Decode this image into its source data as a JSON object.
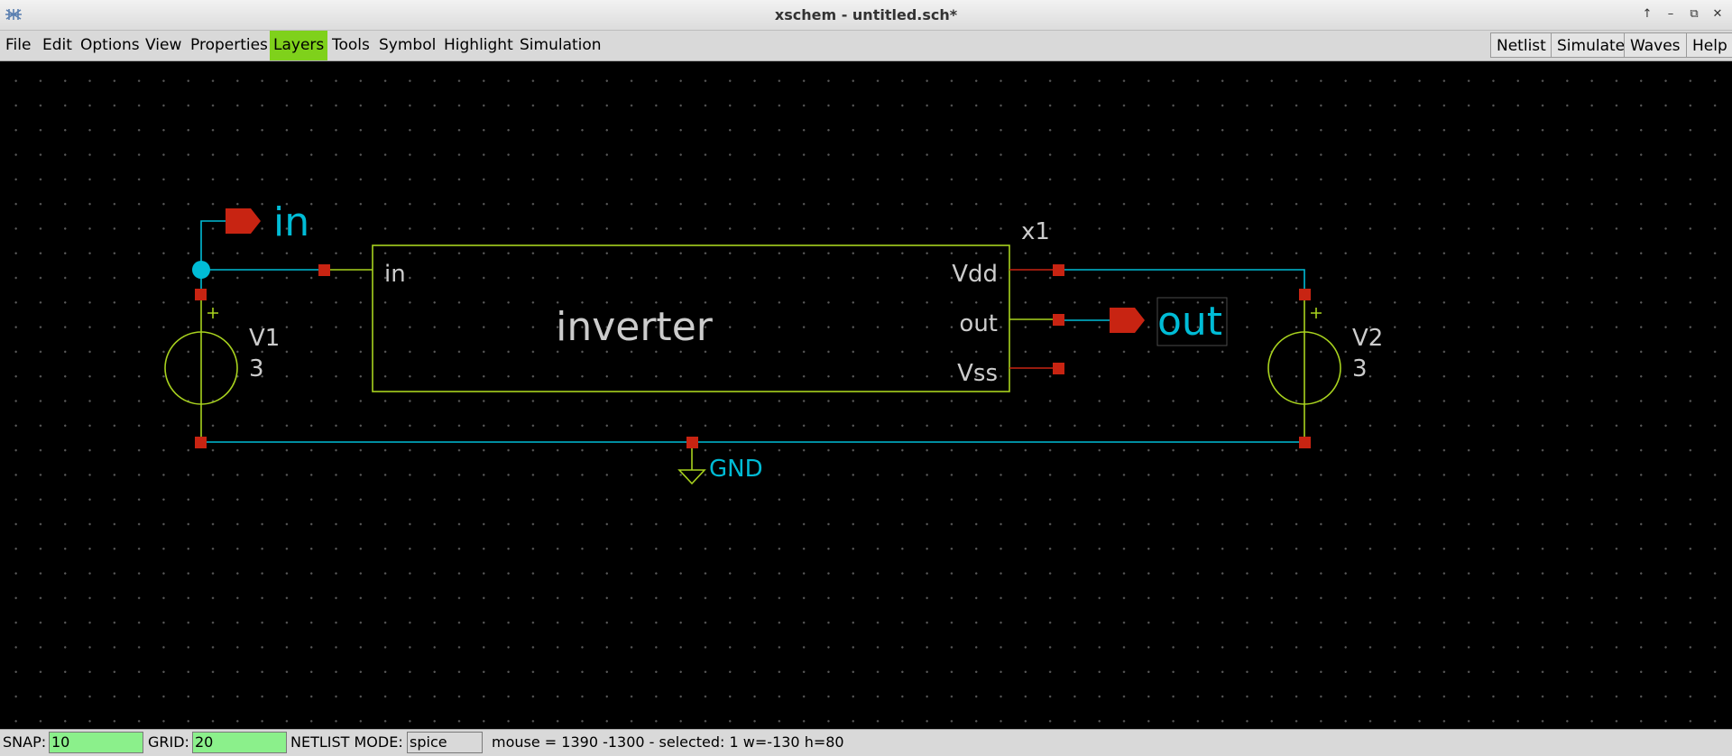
{
  "window": {
    "title": "xschem - untitled.sch*",
    "controls": [
      "up-arrow-icon",
      "minimize-icon",
      "restore-icon",
      "close-icon"
    ]
  },
  "menubar": {
    "items": [
      {
        "label": "File"
      },
      {
        "label": "Edit"
      },
      {
        "label": "Options"
      },
      {
        "label": "View"
      },
      {
        "label": "Properties"
      },
      {
        "label": "Layers",
        "active": true
      },
      {
        "label": "Tools"
      },
      {
        "label": "Symbol"
      },
      {
        "label": "Highlight"
      },
      {
        "label": "Simulation"
      }
    ],
    "right_buttons": [
      {
        "label": "Netlist"
      },
      {
        "label": "Simulate"
      },
      {
        "label": "Waves"
      },
      {
        "label": "Help"
      }
    ]
  },
  "schematic": {
    "instance_name": "x1",
    "symbol_name": "inverter",
    "pins": {
      "in": "in",
      "vdd": "Vdd",
      "out": "out",
      "vss": "Vss"
    },
    "input_label": "in",
    "output_label": "out",
    "gnd_label": "GND",
    "sources": [
      {
        "name": "V1",
        "value": "3"
      },
      {
        "name": "V2",
        "value": "3"
      }
    ],
    "colors": {
      "wire": "#00bcd6",
      "symbol": "#a8d21e",
      "pin": "#c82412",
      "text": "#cccccc",
      "net_label": "#00bcd6"
    }
  },
  "statusbar": {
    "snap_label": "SNAP:",
    "snap_value": "10",
    "grid_label": "GRID:",
    "grid_value": "20",
    "netlist_label": "NETLIST MODE:",
    "netlist_value": "spice",
    "info": "mouse = 1390 -1300 - selected: 1 w=-130 h=80"
  }
}
